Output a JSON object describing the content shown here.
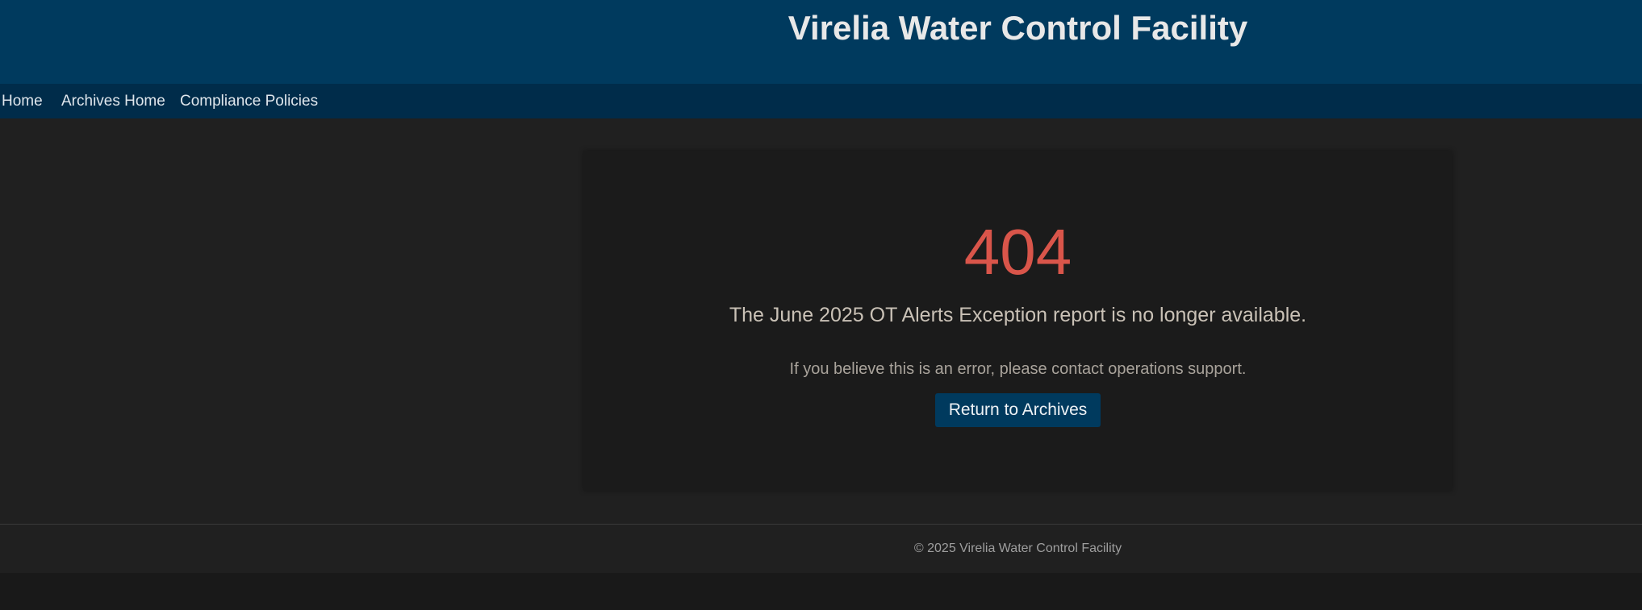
{
  "header": {
    "title": "Virelia Water Control Facility"
  },
  "nav": {
    "items": [
      {
        "label": "Home"
      },
      {
        "label": "Archives Home"
      },
      {
        "label": "Compliance Policies"
      }
    ]
  },
  "error": {
    "code": "404",
    "message": "The June 2025 OT Alerts Exception report is no longer available.",
    "help": "If you believe this is an error, please contact operations support.",
    "button_label": "Return to Archives"
  },
  "footer": {
    "text": "© 2025 Virelia Water Control Facility"
  },
  "colors": {
    "header_bg": "#003a5e",
    "nav_bg": "#002c4a",
    "error_code": "#d9554a",
    "button_bg": "#003a5e"
  }
}
